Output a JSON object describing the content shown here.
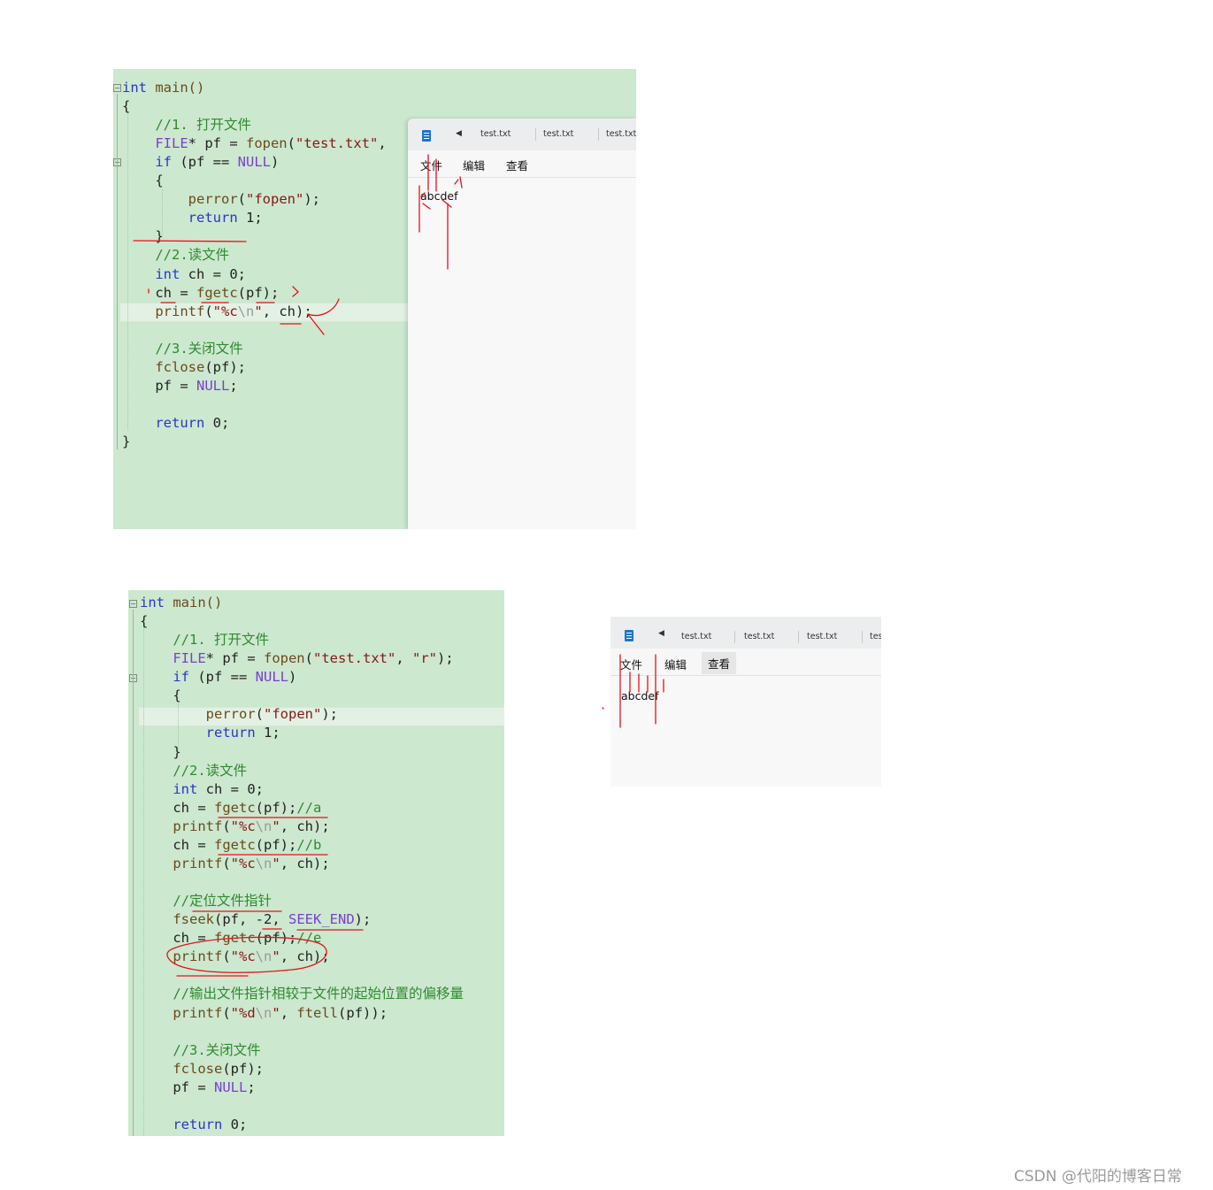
{
  "screenshot1": {
    "code_lines": [
      [
        [
          "kw",
          "int"
        ],
        [
          "fn",
          " main()"
        ]
      ],
      [
        [
          "txt",
          "{"
        ]
      ],
      [
        [
          "cm",
          "    //1. 打开文件"
        ]
      ],
      [
        [
          "mac",
          "    FILE"
        ],
        [
          "txt",
          "* pf = "
        ],
        [
          "fn",
          "fopen"
        ],
        [
          "txt",
          "("
        ],
        [
          "st",
          "\"test.txt\""
        ],
        [
          "txt",
          ","
        ]
      ],
      [
        [
          "kw",
          "    if"
        ],
        [
          "txt",
          " (pf == "
        ],
        [
          "mac",
          "NULL"
        ],
        [
          "txt",
          ")"
        ]
      ],
      [
        [
          "txt",
          "    {"
        ]
      ],
      [
        [
          "fn",
          "        perror"
        ],
        [
          "txt",
          "("
        ],
        [
          "st",
          "\"fopen\""
        ],
        [
          "txt",
          ");"
        ]
      ],
      [
        [
          "kw",
          "        return"
        ],
        [
          "txt",
          " 1;"
        ]
      ],
      [
        [
          "txt",
          "    }"
        ]
      ],
      [
        [
          "cm",
          "    //2.读文件"
        ]
      ],
      [
        [
          "kw",
          "    int"
        ],
        [
          "txt",
          " ch = 0;"
        ]
      ],
      [
        [
          "txt",
          "    ch = "
        ],
        [
          "fn",
          "fgetc"
        ],
        [
          "txt",
          "(pf);"
        ]
      ],
      [
        [
          "fn",
          "    printf"
        ],
        [
          "txt",
          "("
        ],
        [
          "st",
          "\"%c"
        ],
        [
          "esc",
          "\\n"
        ],
        [
          "st",
          "\""
        ],
        [
          "txt",
          ", ch);"
        ]
      ],
      [
        [
          "txt",
          ""
        ]
      ],
      [
        [
          "cm",
          "    //3.关闭文件"
        ]
      ],
      [
        [
          "fn",
          "    fclose"
        ],
        [
          "txt",
          "(pf);"
        ]
      ],
      [
        [
          "txt",
          "    pf = "
        ],
        [
          "mac",
          "NULL"
        ],
        [
          "txt",
          ";"
        ]
      ],
      [
        [
          "txt",
          ""
        ]
      ],
      [
        [
          "kw",
          "    return"
        ],
        [
          "txt",
          " 0;"
        ]
      ],
      [
        [
          "txt",
          "}"
        ]
      ]
    ],
    "notepad": {
      "tabs": [
        "test.txt",
        "test.txt",
        "test.txt"
      ],
      "menu": [
        "文件",
        "编辑",
        "查看"
      ],
      "content": "abcdef"
    }
  },
  "screenshot2": {
    "code_lines": [
      [
        [
          "kw",
          "int"
        ],
        [
          "fn",
          " main()"
        ]
      ],
      [
        [
          "txt",
          "{"
        ]
      ],
      [
        [
          "cm",
          "    //1. 打开文件"
        ]
      ],
      [
        [
          "mac",
          "    FILE"
        ],
        [
          "txt",
          "* pf = "
        ],
        [
          "fn",
          "fopen"
        ],
        [
          "txt",
          "("
        ],
        [
          "st",
          "\"test.txt\""
        ],
        [
          "txt",
          ", "
        ],
        [
          "st",
          "\"r\""
        ],
        [
          "txt",
          ");"
        ]
      ],
      [
        [
          "kw",
          "    if"
        ],
        [
          "txt",
          " (pf == "
        ],
        [
          "mac",
          "NULL"
        ],
        [
          "txt",
          ")"
        ]
      ],
      [
        [
          "txt",
          "    {"
        ]
      ],
      [
        [
          "fn",
          "        perror"
        ],
        [
          "txt",
          "("
        ],
        [
          "st",
          "\"fopen\""
        ],
        [
          "txt",
          ");"
        ]
      ],
      [
        [
          "kw",
          "        return"
        ],
        [
          "txt",
          " 1;"
        ]
      ],
      [
        [
          "txt",
          "    }"
        ]
      ],
      [
        [
          "cm",
          "    //2.读文件"
        ]
      ],
      [
        [
          "kw",
          "    int"
        ],
        [
          "txt",
          " ch = 0;"
        ]
      ],
      [
        [
          "txt",
          "    ch = "
        ],
        [
          "fn",
          "fgetc"
        ],
        [
          "txt",
          "(pf);"
        ],
        [
          "cm",
          "//a"
        ]
      ],
      [
        [
          "fn",
          "    printf"
        ],
        [
          "txt",
          "("
        ],
        [
          "st",
          "\"%c"
        ],
        [
          "esc",
          "\\n"
        ],
        [
          "st",
          "\""
        ],
        [
          "txt",
          ", ch);"
        ]
      ],
      [
        [
          "txt",
          "    ch = "
        ],
        [
          "fn",
          "fgetc"
        ],
        [
          "txt",
          "(pf);"
        ],
        [
          "cm",
          "//b"
        ]
      ],
      [
        [
          "fn",
          "    printf"
        ],
        [
          "txt",
          "("
        ],
        [
          "st",
          "\"%c"
        ],
        [
          "esc",
          "\\n"
        ],
        [
          "st",
          "\""
        ],
        [
          "txt",
          ", ch);"
        ]
      ],
      [
        [
          "txt",
          ""
        ]
      ],
      [
        [
          "cm",
          "    //定位文件指针"
        ]
      ],
      [
        [
          "fn",
          "    fseek"
        ],
        [
          "txt",
          "(pf, -2, "
        ],
        [
          "mac",
          "SEEK_END"
        ],
        [
          "txt",
          ");"
        ]
      ],
      [
        [
          "txt",
          "    ch = "
        ],
        [
          "fn",
          "fgetc"
        ],
        [
          "txt",
          "(pf);"
        ],
        [
          "cm",
          "//e"
        ]
      ],
      [
        [
          "fn",
          "    printf"
        ],
        [
          "txt",
          "("
        ],
        [
          "st",
          "\"%c"
        ],
        [
          "esc",
          "\\n"
        ],
        [
          "st",
          "\""
        ],
        [
          "txt",
          ", ch);"
        ]
      ],
      [
        [
          "txt",
          ""
        ]
      ],
      [
        [
          "cm",
          "    //输出文件指针相较于文件的起始位置的偏移量"
        ]
      ],
      [
        [
          "fn",
          "    printf"
        ],
        [
          "txt",
          "("
        ],
        [
          "st",
          "\"%d"
        ],
        [
          "esc",
          "\\n"
        ],
        [
          "st",
          "\""
        ],
        [
          "txt",
          ", "
        ],
        [
          "fn",
          "ftell"
        ],
        [
          "txt",
          "(pf));"
        ]
      ],
      [
        [
          "txt",
          ""
        ]
      ],
      [
        [
          "cm",
          "    //3.关闭文件"
        ]
      ],
      [
        [
          "fn",
          "    fclose"
        ],
        [
          "txt",
          "(pf);"
        ]
      ],
      [
        [
          "txt",
          "    pf = "
        ],
        [
          "mac",
          "NULL"
        ],
        [
          "txt",
          ";"
        ]
      ],
      [
        [
          "txt",
          ""
        ]
      ],
      [
        [
          "kw",
          "    return"
        ],
        [
          "txt",
          " 0;"
        ]
      ]
    ],
    "notepad": {
      "tabs": [
        "test.txt",
        "test.txt",
        "test.txt",
        "tes"
      ],
      "menu": [
        "文件",
        "编辑",
        "查看"
      ],
      "content": "abcdef"
    }
  },
  "watermark": "CSDN @代阳的博客日常",
  "colors": {
    "editor_bg": "#cce8cf",
    "keyword": "#2b35c8",
    "comment": "#2f8a2f",
    "string": "#8a1616",
    "macro": "#7a3fd0",
    "annotation": "#e8101a"
  }
}
